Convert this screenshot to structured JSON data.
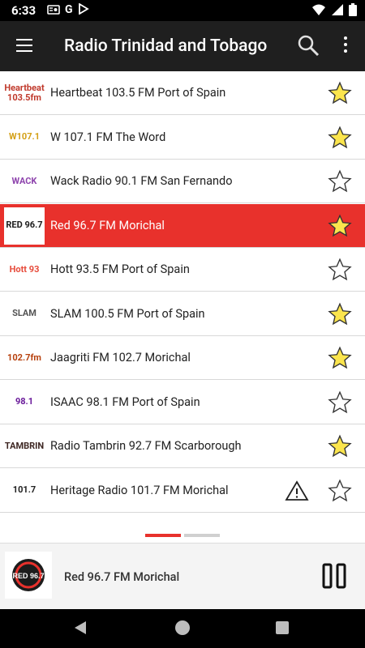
{
  "status_bar": {
    "time": "6:33",
    "icons": [
      "radio-icon",
      "google-icon",
      "play-store-icon"
    ],
    "right_icons": [
      "wifi-icon",
      "signal-icon",
      "battery-icon"
    ]
  },
  "app_bar": {
    "title": "Radio Trinidad and Tobago"
  },
  "stations": [
    {
      "name": "Heartbeat 103.5 FM Port of Spain",
      "logo_text": "Heartbeat 103.5fm",
      "favorite": true,
      "active": false,
      "warning": false
    },
    {
      "name": "W 107.1 FM The Word",
      "logo_text": "W107.1",
      "favorite": true,
      "active": false,
      "warning": false
    },
    {
      "name": "Wack Radio 90.1 FM San Fernando",
      "logo_text": "WACK",
      "favorite": false,
      "active": false,
      "warning": false
    },
    {
      "name": "Red 96.7 FM Morichal",
      "logo_text": "RED 96.7",
      "favorite": true,
      "active": true,
      "warning": false
    },
    {
      "name": "Hott 93.5 FM Port of Spain",
      "logo_text": "Hott 93",
      "favorite": false,
      "active": false,
      "warning": false
    },
    {
      "name": "SLAM 100.5 FM Port of Spain",
      "logo_text": "SLAM",
      "favorite": true,
      "active": false,
      "warning": false
    },
    {
      "name": "Jaagriti FM 102.7 Morichal",
      "logo_text": "102.7fm",
      "favorite": true,
      "active": false,
      "warning": false
    },
    {
      "name": "ISAAC 98.1 FM Port of Spain",
      "logo_text": "98.1",
      "favorite": false,
      "active": false,
      "warning": false
    },
    {
      "name": "Radio Tambrin 92.7 FM Scarborough",
      "logo_text": "TAMBRIN",
      "favorite": true,
      "active": false,
      "warning": false
    },
    {
      "name": "Heritage Radio 101.7 FM Morichal",
      "logo_text": "101.7",
      "favorite": false,
      "active": false,
      "warning": true
    }
  ],
  "player": {
    "station": "Red 96.7 FM Morichal",
    "logo_text": "RED 96.7"
  },
  "colors": {
    "accent": "#e8312c",
    "star": "#fbe54d",
    "app_bar": "#1f1f1f"
  }
}
